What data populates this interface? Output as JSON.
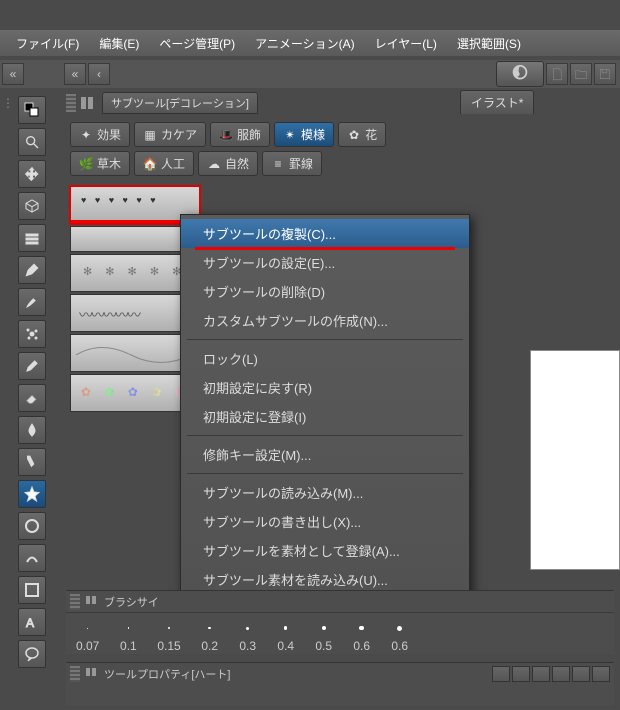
{
  "menu": {
    "file": "ファイル(F)",
    "edit": "編集(E)",
    "page": "ページ管理(P)",
    "anim": "アニメーション(A)",
    "layer": "レイヤー(L)",
    "selection": "選択範囲(S)"
  },
  "doc_tab": "イラスト*",
  "subtool_panel_title": "サブツール[デコレーション]",
  "categories": {
    "row1": [
      {
        "label": "効果",
        "sel": false
      },
      {
        "label": "カケア",
        "sel": false
      },
      {
        "label": "服飾",
        "sel": false
      },
      {
        "label": "模様",
        "sel": true
      },
      {
        "label": "花",
        "sel": false
      }
    ],
    "row2": [
      {
        "label": "草木",
        "sel": false
      },
      {
        "label": "人工",
        "sel": false
      },
      {
        "label": "自然",
        "sel": false
      },
      {
        "label": "罫線",
        "sel": false
      }
    ]
  },
  "context_menu": {
    "duplicate": "サブツールの複製(C)...",
    "settings": "サブツールの設定(E)...",
    "delete": "サブツールの削除(D)",
    "custom": "カスタムサブツールの作成(N)...",
    "lock": "ロック(L)",
    "reset": "初期設定に戻す(R)",
    "register": "初期設定に登録(I)",
    "modkey": "修飾キー設定(M)...",
    "import": "サブツールの読み込み(M)...",
    "export": "サブツールの書き出し(X)...",
    "asmat": "サブツールを素材として登録(A)...",
    "matimp": "サブツール素材を読み込み(U)..."
  },
  "brush_size_panel_title": "ブラシサイ",
  "brush_sizes": [
    "0.07",
    "0.1",
    "0.15",
    "0.2",
    "0.3",
    "0.4",
    "0.5",
    "0.6",
    "0.6"
  ],
  "tool_prop_title": "ツールプロパティ[ハート]"
}
